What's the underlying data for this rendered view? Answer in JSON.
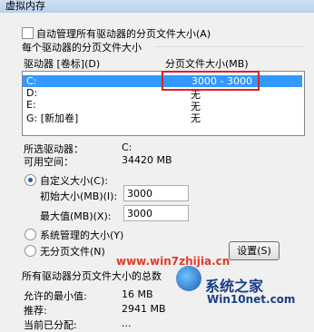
{
  "window": {
    "title": "虚拟内存"
  },
  "auto_manage": {
    "label": "自动管理所有驱动器的分页文件大小(A)",
    "checked": false
  },
  "group_title": "每个驱动器的分页文件大小",
  "list": {
    "col_drive": "驱动器 [卷标](D)",
    "col_size": "分页文件大小(MB)",
    "rows": [
      {
        "drive": "C:",
        "size": "3000 - 3000",
        "selected": true
      },
      {
        "drive": "D:",
        "size": "无"
      },
      {
        "drive": "E:",
        "size": "无"
      },
      {
        "drive": "G:      [新加卷]",
        "size": "无"
      }
    ]
  },
  "selected_drive": {
    "label": "所选驱动器：",
    "value": "C:"
  },
  "free_space": {
    "label": "可用空间：",
    "value": "34420 MB"
  },
  "custom_size": {
    "label": "自定义大小(C):",
    "selected": true
  },
  "initial_size": {
    "label": "初始大小(MB)(I):",
    "value": "3000"
  },
  "max_size": {
    "label": "最大值(MB)(X):",
    "value": "3000"
  },
  "system_managed": {
    "label": "系统管理的大小(Y)"
  },
  "no_paging": {
    "label": "无分页文件(N)"
  },
  "set_button": "设置(S)",
  "totals": {
    "title": "所有驱动器分页文件大小的总数",
    "min_label": "允许的最小值:",
    "min_value": "16 MB",
    "rec_label": "推荐:",
    "rec_value": "2941 MB",
    "cur_label": "当前已分配:",
    "cur_value": "..."
  },
  "watermark": {
    "url": "www.win7zhijia.cn",
    "brand_cn": "系统之家",
    "brand_en": "Win10net.com"
  },
  "colors": {
    "selection": "#3399ff",
    "highlight": "#d9222a",
    "watermark": "#e23a2a"
  }
}
